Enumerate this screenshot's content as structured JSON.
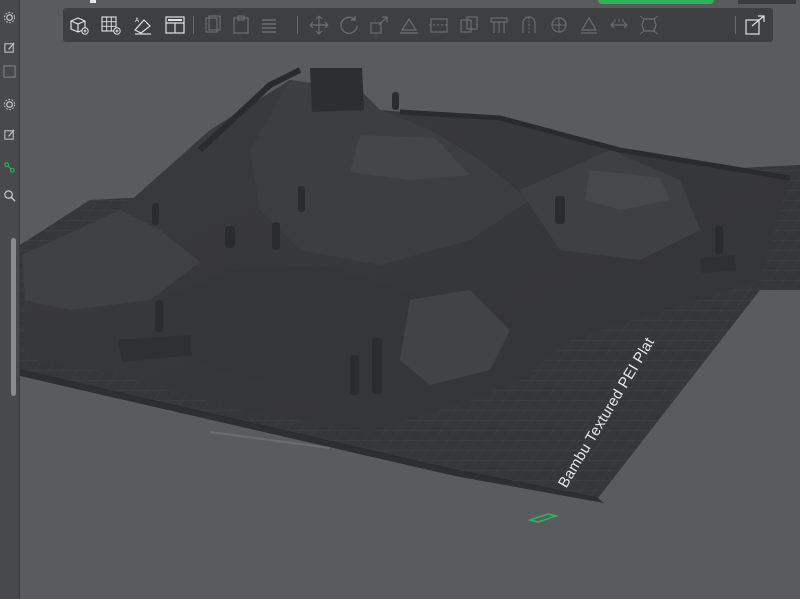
{
  "plate": {
    "label": "Bambu Textured PEI Plat"
  },
  "colors": {
    "background": "#5a5b5d",
    "plate": "#3a3b3e",
    "model": "#3b3c3f",
    "toolbar": "#3e3f41",
    "accent_green": "#2fb35a"
  },
  "toolbar": {
    "buttons": [
      {
        "name": "add-object-icon"
      },
      {
        "name": "arrange-grid-icon"
      },
      {
        "name": "auto-orient-icon"
      },
      {
        "name": "split-plate-icon"
      },
      {
        "name": "copy-icon"
      },
      {
        "name": "paste-icon"
      },
      {
        "name": "layers-list-icon"
      },
      {
        "name": "move-icon"
      },
      {
        "name": "rotate-icon"
      },
      {
        "name": "scale-icon"
      },
      {
        "name": "lay-on-face-icon"
      },
      {
        "name": "cut-icon"
      },
      {
        "name": "mesh-boolean-icon"
      },
      {
        "name": "support-paint-icon"
      },
      {
        "name": "seam-paint-icon"
      },
      {
        "name": "color-paint-icon"
      },
      {
        "name": "text-emboss-icon"
      },
      {
        "name": "measure-icon"
      },
      {
        "name": "assembly-view-icon"
      }
    ]
  },
  "left_strip": {
    "items": [
      {
        "name": "settings-icon"
      },
      {
        "name": "edit-icon"
      },
      {
        "name": "box-icon"
      },
      {
        "name": "settings-icon-2"
      },
      {
        "name": "edit-icon-2"
      },
      {
        "name": "connect-icon"
      },
      {
        "name": "search-icon"
      }
    ]
  }
}
